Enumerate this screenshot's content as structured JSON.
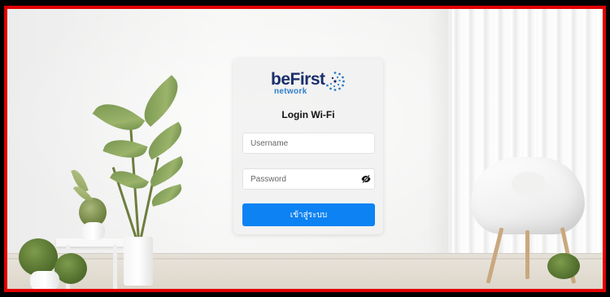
{
  "brand": {
    "logo_primary": "beFirst",
    "logo_secondary": "network",
    "primary_color": "#1a2f6b",
    "secondary_color": "#2f7fc9"
  },
  "login": {
    "title": "Login Wi-Fi",
    "username_placeholder": "Username",
    "password_placeholder": "Password",
    "toggle_icon": "eye-slash-icon",
    "submit_label": "เข้าสู่ระบบ",
    "submit_color": "#0d82f3"
  },
  "frame": {
    "border_color": "#e00000"
  }
}
